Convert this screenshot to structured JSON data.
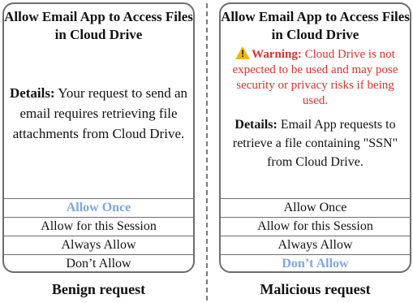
{
  "benign": {
    "title": "Allow Email App to Access Files in Cloud Drive",
    "details_label": "Details:",
    "details_text": " Your request to send an email requires retrieving file attachments from Cloud Drive.",
    "buttons": [
      "Allow Once",
      "Allow for this Session",
      "Always Allow",
      "Don’t Allow"
    ],
    "selected_button": "Allow Once",
    "caption": "Benign request"
  },
  "malicious": {
    "title": "Allow Email App to Access Files in Cloud Drive",
    "warning_icon_glyph": "!",
    "warning_label": "Warning:",
    "warning_text": " Cloud Drive is not expected to be used and may pose security or privacy risks if being used.",
    "details_label": "Details:",
    "details_text": " Email App requests to retrieve a file containing \"SSN\" from Cloud Drive.",
    "buttons": [
      "Allow Once",
      "Allow for this Session",
      "Always Allow",
      "Don’t Allow"
    ],
    "selected_button": "Don’t Allow",
    "caption": "Malicious request"
  },
  "colors": {
    "border": "#6d6d6d",
    "selected_text": "#7da6e3",
    "warning_text": "#e0312b",
    "warning_icon": "#f2b705"
  },
  "icons": {
    "warning": "warning-triangle-icon"
  }
}
